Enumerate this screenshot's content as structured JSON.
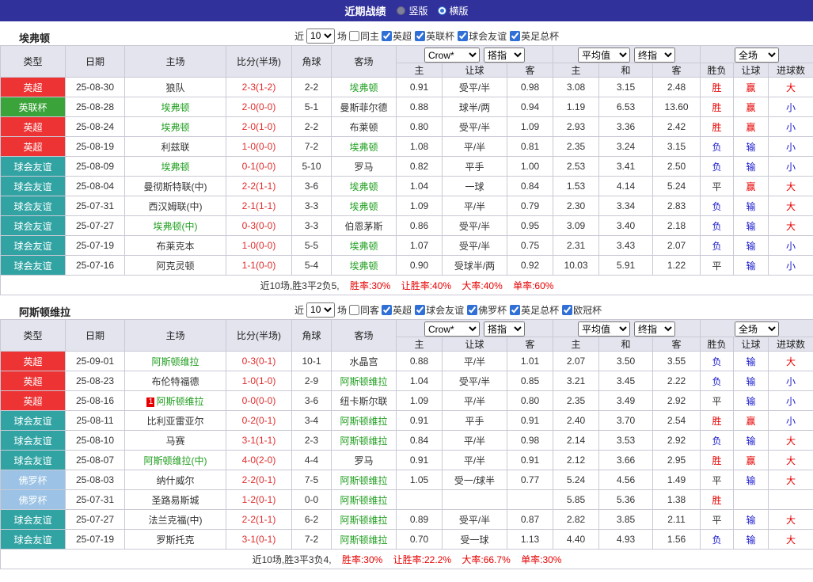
{
  "topbar": {
    "title": "近期战绩",
    "options": [
      {
        "label": "竖版",
        "selected": false
      },
      {
        "label": "横版",
        "selected": true
      }
    ]
  },
  "colors": {
    "competition": {
      "英超": "#ed3333",
      "英联杯": "#3aa33a",
      "球会友谊": "#31a3a3",
      "佛罗杯": "#9cc3e5"
    },
    "win": "#e60000",
    "lose": "#1a1acc",
    "draw": "#333333",
    "team_highlight": "#1f9e1f",
    "score": "#e02b2b",
    "topbar_bg": "#31319c"
  },
  "table_headers": {
    "type": "类型",
    "date": "日期",
    "home": "主场",
    "score": "比分(半场)",
    "corner": "角球",
    "away": "客场",
    "h": "主",
    "handicap": "让球",
    "a": "客",
    "avg_h": "主",
    "avg_d": "和",
    "avg_a": "客",
    "result": "胜负",
    "cover": "让球",
    "goals": "进球数"
  },
  "sections": [
    {
      "team": "埃弗顿",
      "filter": {
        "near": "近",
        "count": "10",
        "games": "场",
        "venue_label": "同主",
        "venue_checked": false,
        "competitions": [
          {
            "label": "英超",
            "checked": true
          },
          {
            "label": "英联杯",
            "checked": true
          },
          {
            "label": "球会友谊",
            "checked": true
          },
          {
            "label": "英足总杯",
            "checked": true
          }
        ]
      },
      "selects": {
        "book": "Crow*",
        "book_idx": "搭指",
        "avg": "平均值",
        "avg_idx": "终指",
        "scope": "全场"
      },
      "rows": [
        {
          "type": "英超",
          "date": "25-08-30",
          "home": "狼队",
          "home_hl": false,
          "score": "2-3(1-2)",
          "corner": "2-2",
          "away": "埃弗顿",
          "away_hl": true,
          "o1": "0.91",
          "hc": "受平/半",
          "o2": "0.98",
          "m1": "3.08",
          "m2": "3.15",
          "m3": "2.48",
          "res": "胜",
          "cov": "赢",
          "size": "大"
        },
        {
          "type": "英联杯",
          "date": "25-08-28",
          "home": "埃弗顿",
          "home_hl": true,
          "score": "2-0(0-0)",
          "corner": "5-1",
          "away": "曼斯菲尔德",
          "away_hl": false,
          "o1": "0.88",
          "hc": "球半/两",
          "o2": "0.94",
          "m1": "1.19",
          "m2": "6.53",
          "m3": "13.60",
          "res": "胜",
          "cov": "赢",
          "size": "小"
        },
        {
          "type": "英超",
          "date": "25-08-24",
          "home": "埃弗顿",
          "home_hl": true,
          "score": "2-0(1-0)",
          "corner": "2-2",
          "away": "布莱顿",
          "away_hl": false,
          "o1": "0.80",
          "hc": "受平/半",
          "o2": "1.09",
          "m1": "2.93",
          "m2": "3.36",
          "m3": "2.42",
          "res": "胜",
          "cov": "赢",
          "size": "小"
        },
        {
          "type": "英超",
          "date": "25-08-19",
          "home": "利兹联",
          "home_hl": false,
          "score": "1-0(0-0)",
          "corner": "7-2",
          "away": "埃弗顿",
          "away_hl": true,
          "o1": "1.08",
          "hc": "平/半",
          "o2": "0.81",
          "m1": "2.35",
          "m2": "3.24",
          "m3": "3.15",
          "res": "负",
          "cov": "输",
          "size": "小"
        },
        {
          "type": "球会友谊",
          "date": "25-08-09",
          "home": "埃弗顿",
          "home_hl": true,
          "score": "0-1(0-0)",
          "corner": "5-10",
          "away": "罗马",
          "away_hl": false,
          "o1": "0.82",
          "hc": "平手",
          "o2": "1.00",
          "m1": "2.53",
          "m2": "3.41",
          "m3": "2.50",
          "res": "负",
          "cov": "输",
          "size": "小"
        },
        {
          "type": "球会友谊",
          "date": "25-08-04",
          "home": "曼彻斯特联(中)",
          "home_hl": false,
          "score": "2-2(1-1)",
          "corner": "3-6",
          "away": "埃弗顿",
          "away_hl": true,
          "o1": "1.04",
          "hc": "一球",
          "o2": "0.84",
          "m1": "1.53",
          "m2": "4.14",
          "m3": "5.24",
          "res": "平",
          "cov": "赢",
          "size": "大"
        },
        {
          "type": "球会友谊",
          "date": "25-07-31",
          "home": "西汉姆联(中)",
          "home_hl": false,
          "score": "2-1(1-1)",
          "corner": "3-3",
          "away": "埃弗顿",
          "away_hl": true,
          "o1": "1.09",
          "hc": "平/半",
          "o2": "0.79",
          "m1": "2.30",
          "m2": "3.34",
          "m3": "2.83",
          "res": "负",
          "cov": "输",
          "size": "大"
        },
        {
          "type": "球会友谊",
          "date": "25-07-27",
          "home": "埃弗顿(中)",
          "home_hl": true,
          "score": "0-3(0-0)",
          "corner": "3-3",
          "away": "伯恩茅斯",
          "away_hl": false,
          "o1": "0.86",
          "hc": "受平/半",
          "o2": "0.95",
          "m1": "3.09",
          "m2": "3.40",
          "m3": "2.18",
          "res": "负",
          "cov": "输",
          "size": "大"
        },
        {
          "type": "球会友谊",
          "date": "25-07-19",
          "home": "布莱克本",
          "home_hl": false,
          "score": "1-0(0-0)",
          "corner": "5-5",
          "away": "埃弗顿",
          "away_hl": true,
          "o1": "1.07",
          "hc": "受平/半",
          "o2": "0.75",
          "m1": "2.31",
          "m2": "3.43",
          "m3": "2.07",
          "res": "负",
          "cov": "输",
          "size": "小"
        },
        {
          "type": "球会友谊",
          "date": "25-07-16",
          "home": "阿克灵顿",
          "home_hl": false,
          "score": "1-1(0-0)",
          "corner": "5-4",
          "away": "埃弗顿",
          "away_hl": true,
          "o1": "0.90",
          "hc": "受球半/两",
          "o2": "0.92",
          "m1": "10.03",
          "m2": "5.91",
          "m3": "1.22",
          "res": "平",
          "cov": "输",
          "size": "小"
        }
      ],
      "summary": {
        "prefix": "近10场,胜3平2负5,",
        "stats": [
          "胜率:30%",
          "让胜率:40%",
          "大率:40%",
          "单率:60%"
        ]
      }
    },
    {
      "team": "阿斯顿维拉",
      "filter": {
        "near": "近",
        "count": "10",
        "games": "场",
        "venue_label": "同客",
        "venue_checked": false,
        "competitions": [
          {
            "label": "英超",
            "checked": true
          },
          {
            "label": "球会友谊",
            "checked": true
          },
          {
            "label": "佛罗杯",
            "checked": true
          },
          {
            "label": "英足总杯",
            "checked": true
          },
          {
            "label": "欧冠杯",
            "checked": true
          }
        ]
      },
      "selects": {
        "book": "Crow*",
        "book_idx": "搭指",
        "avg": "平均值",
        "avg_idx": "终指",
        "scope": "全场"
      },
      "rows": [
        {
          "type": "英超",
          "date": "25-09-01",
          "home": "阿斯顿维拉",
          "home_hl": true,
          "score": "0-3(0-1)",
          "corner": "10-1",
          "away": "水晶宫",
          "away_hl": false,
          "o1": "0.88",
          "hc": "平/半",
          "o2": "1.01",
          "m1": "2.07",
          "m2": "3.50",
          "m3": "3.55",
          "res": "负",
          "cov": "输",
          "size": "大"
        },
        {
          "type": "英超",
          "date": "25-08-23",
          "home": "布伦特福德",
          "home_hl": false,
          "score": "1-0(1-0)",
          "corner": "2-9",
          "away": "阿斯顿维拉",
          "away_hl": true,
          "o1": "1.04",
          "hc": "受平/半",
          "o2": "0.85",
          "m1": "3.21",
          "m2": "3.45",
          "m3": "2.22",
          "res": "负",
          "cov": "输",
          "size": "小"
        },
        {
          "type": "英超",
          "date": "25-08-16",
          "home": "阿斯顿维拉",
          "home_hl": true,
          "home_card": "1",
          "score": "0-0(0-0)",
          "corner": "3-6",
          "away": "纽卡斯尔联",
          "away_hl": false,
          "o1": "1.09",
          "hc": "平/半",
          "o2": "0.80",
          "m1": "2.35",
          "m2": "3.49",
          "m3": "2.92",
          "res": "平",
          "cov": "输",
          "size": "小"
        },
        {
          "type": "球会友谊",
          "date": "25-08-11",
          "home": "比利亚雷亚尔",
          "home_hl": false,
          "score": "0-2(0-1)",
          "corner": "3-4",
          "away": "阿斯顿维拉",
          "away_hl": true,
          "o1": "0.91",
          "hc": "平手",
          "o2": "0.91",
          "m1": "2.40",
          "m2": "3.70",
          "m3": "2.54",
          "res": "胜",
          "cov": "赢",
          "size": "小"
        },
        {
          "type": "球会友谊",
          "date": "25-08-10",
          "home": "马赛",
          "home_hl": false,
          "score": "3-1(1-1)",
          "corner": "2-3",
          "away": "阿斯顿维拉",
          "away_hl": true,
          "o1": "0.84",
          "hc": "平/半",
          "o2": "0.98",
          "m1": "2.14",
          "m2": "3.53",
          "m3": "2.92",
          "res": "负",
          "cov": "输",
          "size": "大"
        },
        {
          "type": "球会友谊",
          "date": "25-08-07",
          "home": "阿斯顿维拉(中)",
          "home_hl": true,
          "score": "4-0(2-0)",
          "corner": "4-4",
          "away": "罗马",
          "away_hl": false,
          "o1": "0.91",
          "hc": "平/半",
          "o2": "0.91",
          "m1": "2.12",
          "m2": "3.66",
          "m3": "2.95",
          "res": "胜",
          "cov": "赢",
          "size": "大"
        },
        {
          "type": "佛罗杯",
          "date": "25-08-03",
          "home": "纳什威尔",
          "home_hl": false,
          "score": "2-2(0-1)",
          "corner": "7-5",
          "away": "阿斯顿维拉",
          "away_hl": true,
          "o1": "1.05",
          "hc": "受一/球半",
          "o2": "0.77",
          "m1": "5.24",
          "m2": "4.56",
          "m3": "1.49",
          "res": "平",
          "cov": "输",
          "size": "大"
        },
        {
          "type": "佛罗杯",
          "date": "25-07-31",
          "home": "圣路易斯城",
          "home_hl": false,
          "score": "1-2(0-1)",
          "corner": "0-0",
          "away": "阿斯顿维拉",
          "away_hl": true,
          "o1": "",
          "hc": "",
          "o2": "",
          "m1": "5.85",
          "m2": "5.36",
          "m3": "1.38",
          "res": "胜",
          "cov": "",
          "size": ""
        },
        {
          "type": "球会友谊",
          "date": "25-07-27",
          "home": "法兰克福(中)",
          "home_hl": false,
          "score": "2-2(1-1)",
          "corner": "6-2",
          "away": "阿斯顿维拉",
          "away_hl": true,
          "o1": "0.89",
          "hc": "受平/半",
          "o2": "0.87",
          "m1": "2.82",
          "m2": "3.85",
          "m3": "2.11",
          "res": "平",
          "cov": "输",
          "size": "大"
        },
        {
          "type": "球会友谊",
          "date": "25-07-19",
          "home": "罗斯托克",
          "home_hl": false,
          "score": "3-1(0-1)",
          "corner": "7-2",
          "away": "阿斯顿维拉",
          "away_hl": true,
          "o1": "0.70",
          "hc": "受一球",
          "o2": "1.13",
          "m1": "4.40",
          "m2": "4.93",
          "m3": "1.56",
          "res": "负",
          "cov": "输",
          "size": "大"
        }
      ],
      "summary": {
        "prefix": "近10场,胜3平3负4,",
        "stats": [
          "胜率:30%",
          "让胜率:22.2%",
          "大率:66.7%",
          "单率:30%"
        ]
      }
    }
  ]
}
